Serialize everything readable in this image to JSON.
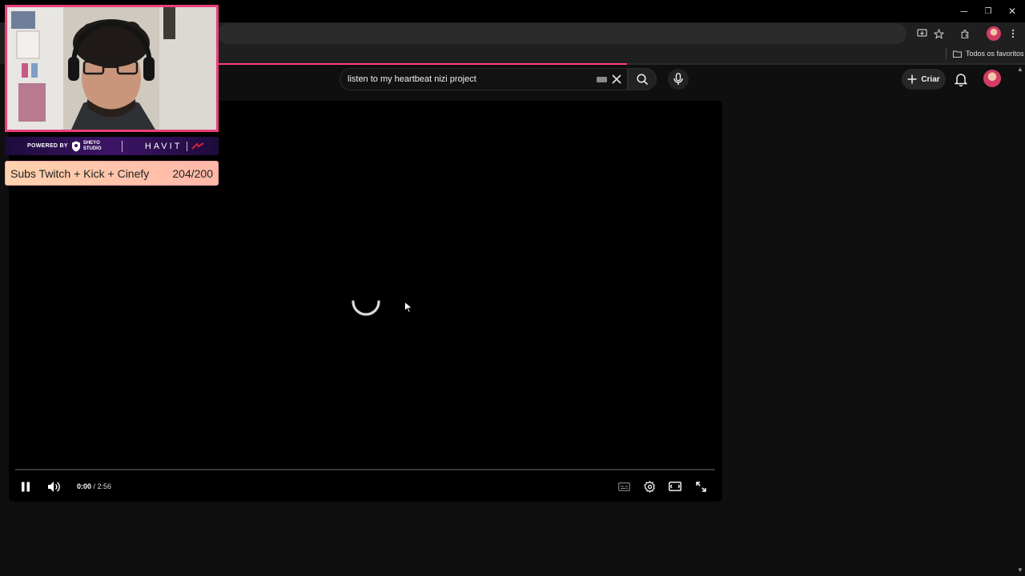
{
  "browser": {
    "bookmarks_bar": {
      "all_bookmarks_label": "Todos os favoritos"
    },
    "window_controls": {
      "minimize": "─",
      "restore": "❐",
      "close": "✕"
    }
  },
  "masthead": {
    "search": {
      "query": "listen to my heartbeat nizi project"
    },
    "create_label": "Criar"
  },
  "player": {
    "current_time": "0:00",
    "time_separator": " / ",
    "duration": "2:56",
    "state": "loading",
    "progress": 0
  },
  "overlay": {
    "sponsor": {
      "powered_by": "POWERED BY",
      "brand_small": "SHEYO STUDIO",
      "brand": "HAVIT"
    },
    "subs_goal": {
      "label": "Subs Twitch + Kick + Cinefy",
      "count": "204/200"
    }
  },
  "colors": {
    "accent": "#ff3a86",
    "overlay_border": "#ec3f78",
    "page_bg": "#0f0f0f",
    "player_bg": "#000000"
  },
  "icons": [
    "search-icon",
    "mic-icon",
    "keyboard-icon",
    "clear-icon",
    "plus-icon",
    "bell-icon",
    "pause-icon",
    "volume-icon",
    "subtitles-icon",
    "settings-icon",
    "theater-icon",
    "fullscreen-icon",
    "install-icon",
    "star-icon",
    "extensions-icon",
    "menu-icon",
    "folder-icon"
  ]
}
